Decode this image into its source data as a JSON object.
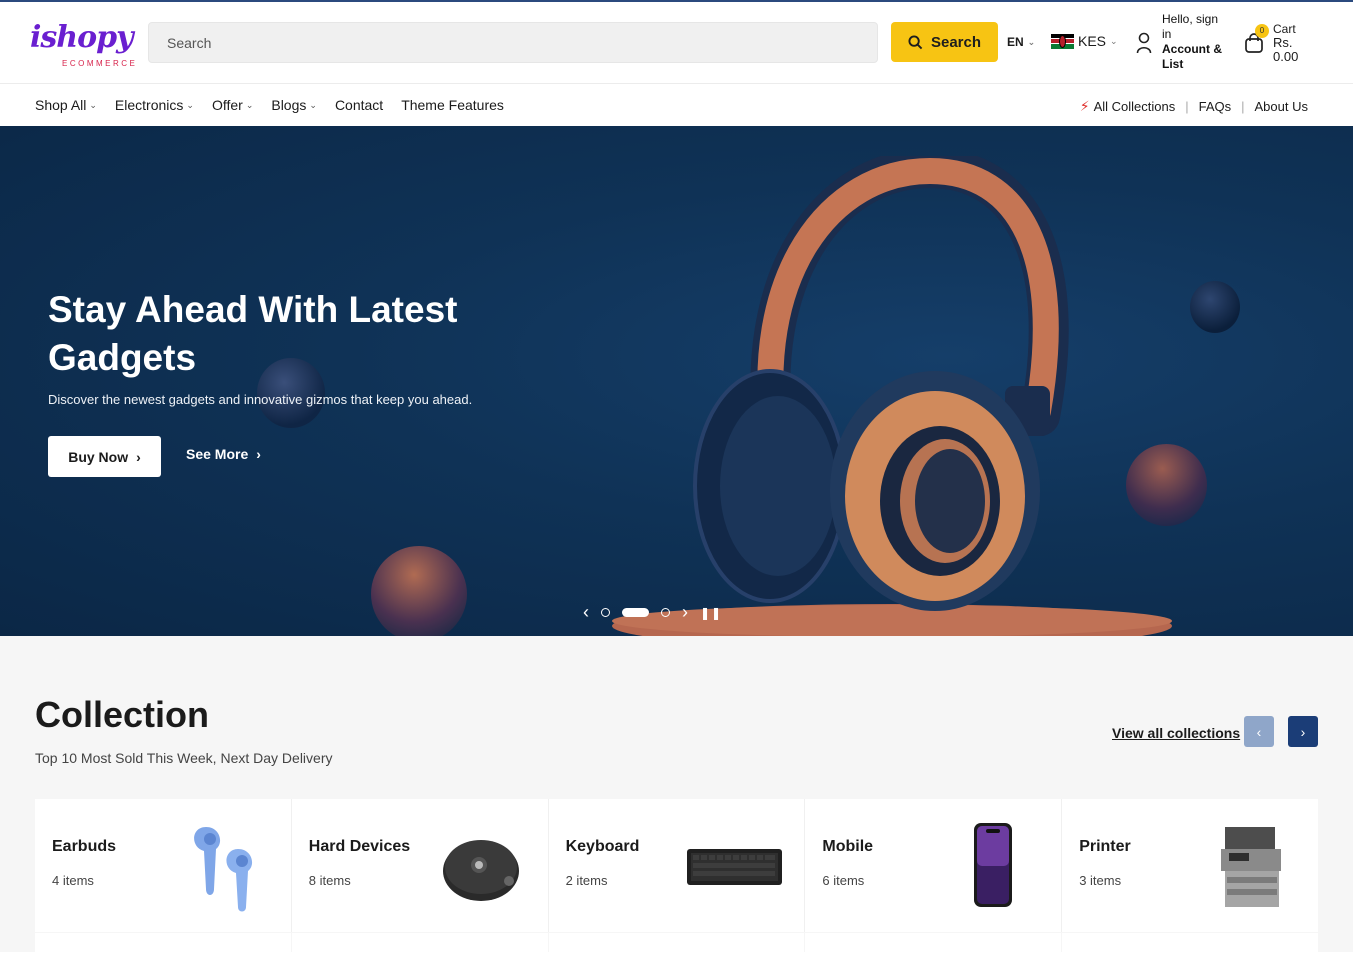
{
  "header": {
    "logo_text": "ishopy",
    "logo_sub": "ECOMMERCE",
    "search_placeholder": "Search",
    "search_button": "Search",
    "language": "EN",
    "currency": "KES",
    "account_greeting": "Hello, sign in",
    "account_label": "Account & List",
    "cart_label": "Cart",
    "cart_count": "0",
    "cart_total": "Rs. 0.00"
  },
  "nav": {
    "items": [
      {
        "label": "Shop All",
        "dropdown": true
      },
      {
        "label": "Electronics",
        "dropdown": true
      },
      {
        "label": "Offer",
        "dropdown": true
      },
      {
        "label": "Blogs",
        "dropdown": true
      },
      {
        "label": "Contact",
        "dropdown": false
      },
      {
        "label": "Theme Features",
        "dropdown": false
      }
    ],
    "right_links": [
      "All Collections",
      "FAQs",
      "About Us"
    ]
  },
  "hero": {
    "title": "Stay Ahead With Latest Gadgets",
    "subtitle": "Discover the newest gadgets and innovative gizmos that keep you ahead.",
    "primary_button": "Buy Now",
    "secondary_button": "See More",
    "active_slide": 2,
    "slide_count": 3
  },
  "collection": {
    "title": "Collection",
    "subtitle": "Top 10 Most Sold This Week, Next Day Delivery",
    "view_all": "View all collections",
    "items": [
      {
        "name": "Earbuds",
        "count": "4 items"
      },
      {
        "name": "Hard Devices",
        "count": "8 items"
      },
      {
        "name": "Keyboard",
        "count": "2 items"
      },
      {
        "name": "Mobile",
        "count": "6 items"
      },
      {
        "name": "Printer",
        "count": "3 items"
      }
    ]
  },
  "colors": {
    "brand": "#6a1fd0",
    "accent": "#f7c413",
    "hero_bg": "#0f3256",
    "nav_next": "#1b3d77"
  }
}
